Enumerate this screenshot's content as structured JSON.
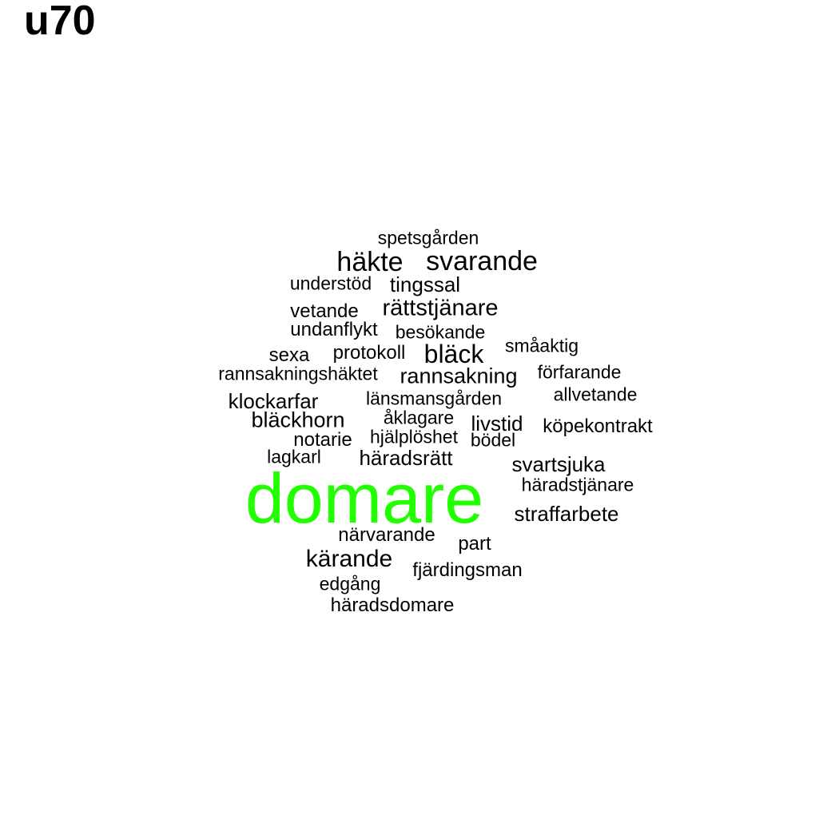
{
  "title": "u70",
  "highlight_color": "#22ff00",
  "default_color": "#000000",
  "words": [
    {
      "text": "domare",
      "highlight": true
    },
    {
      "text": "häkte"
    },
    {
      "text": "svarande"
    },
    {
      "text": "rättstjänare"
    },
    {
      "text": "bläck"
    },
    {
      "text": "rannsakning"
    },
    {
      "text": "kärande"
    },
    {
      "text": "bläckhorn"
    },
    {
      "text": "klockarfar"
    },
    {
      "text": "svartsjuka"
    },
    {
      "text": "straffarbete"
    },
    {
      "text": "häradsrätt"
    },
    {
      "text": "tingssal"
    },
    {
      "text": "livstid"
    },
    {
      "text": "spetsgården"
    },
    {
      "text": "understöd"
    },
    {
      "text": "vetande"
    },
    {
      "text": "undanflykt"
    },
    {
      "text": "besökande"
    },
    {
      "text": "sexa"
    },
    {
      "text": "protokoll"
    },
    {
      "text": "småaktig"
    },
    {
      "text": "rannsakningshäktet"
    },
    {
      "text": "förfarande"
    },
    {
      "text": "allvetande"
    },
    {
      "text": "länsmansgården"
    },
    {
      "text": "åklagare"
    },
    {
      "text": "köpekontrakt"
    },
    {
      "text": "notarie"
    },
    {
      "text": "hjälplöshet"
    },
    {
      "text": "bödel"
    },
    {
      "text": "lagkarl"
    },
    {
      "text": "häradstjänare"
    },
    {
      "text": "närvarande"
    },
    {
      "text": "part"
    },
    {
      "text": "fjärdingsman"
    },
    {
      "text": "edgång"
    },
    {
      "text": "häradsdomare"
    }
  ]
}
